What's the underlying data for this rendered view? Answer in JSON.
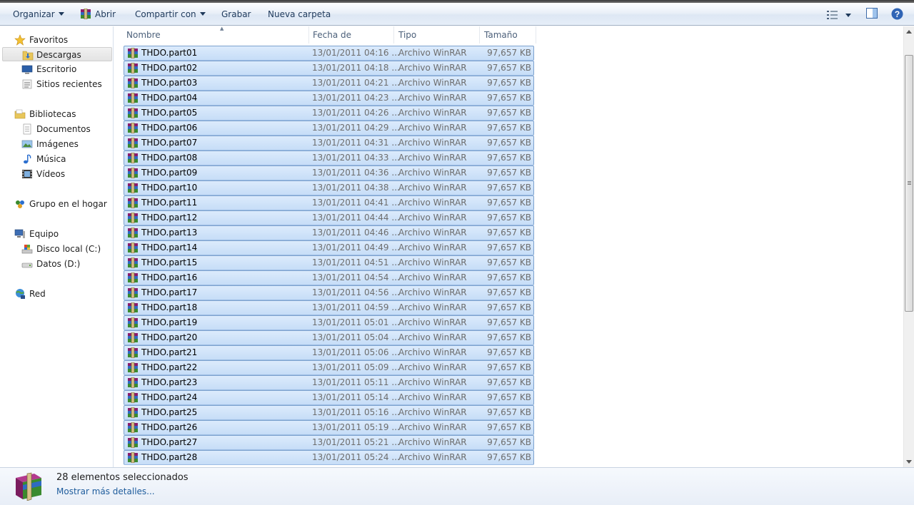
{
  "toolbar": {
    "organize": "Organizar",
    "open": "Abrir",
    "share": "Compartir con",
    "burn": "Grabar",
    "new_folder": "Nueva carpeta"
  },
  "nav": {
    "favorites": "Favoritos",
    "downloads": "Descargas",
    "desktop": "Escritorio",
    "recent": "Sitios recientes",
    "libraries": "Bibliotecas",
    "documents": "Documentos",
    "pictures": "Imágenes",
    "music": "Música",
    "videos": "Vídeos",
    "homegroup": "Grupo en el hogar",
    "computer": "Equipo",
    "local_disk": "Disco local (C:)",
    "data_disk": "Datos (D:)",
    "network": "Red"
  },
  "columns": {
    "name": "Nombre",
    "date": "Fecha de modifica...",
    "type": "Tipo",
    "size": "Tamaño"
  },
  "files": [
    {
      "name": "THDO.part01",
      "date": "13/01/2011 04:16 ...",
      "type": "Archivo WinRAR",
      "size": "97,657 KB"
    },
    {
      "name": "THDO.part02",
      "date": "13/01/2011 04:18 ...",
      "type": "Archivo WinRAR",
      "size": "97,657 KB"
    },
    {
      "name": "THDO.part03",
      "date": "13/01/2011 04:21 ...",
      "type": "Archivo WinRAR",
      "size": "97,657 KB"
    },
    {
      "name": "THDO.part04",
      "date": "13/01/2011 04:23 ...",
      "type": "Archivo WinRAR",
      "size": "97,657 KB"
    },
    {
      "name": "THDO.part05",
      "date": "13/01/2011 04:26 ...",
      "type": "Archivo WinRAR",
      "size": "97,657 KB"
    },
    {
      "name": "THDO.part06",
      "date": "13/01/2011 04:29 ...",
      "type": "Archivo WinRAR",
      "size": "97,657 KB"
    },
    {
      "name": "THDO.part07",
      "date": "13/01/2011 04:31 ...",
      "type": "Archivo WinRAR",
      "size": "97,657 KB"
    },
    {
      "name": "THDO.part08",
      "date": "13/01/2011 04:33 ...",
      "type": "Archivo WinRAR",
      "size": "97,657 KB"
    },
    {
      "name": "THDO.part09",
      "date": "13/01/2011 04:36 ...",
      "type": "Archivo WinRAR",
      "size": "97,657 KB"
    },
    {
      "name": "THDO.part10",
      "date": "13/01/2011 04:38 ...",
      "type": "Archivo WinRAR",
      "size": "97,657 KB"
    },
    {
      "name": "THDO.part11",
      "date": "13/01/2011 04:41 ...",
      "type": "Archivo WinRAR",
      "size": "97,657 KB"
    },
    {
      "name": "THDO.part12",
      "date": "13/01/2011 04:44 ...",
      "type": "Archivo WinRAR",
      "size": "97,657 KB"
    },
    {
      "name": "THDO.part13",
      "date": "13/01/2011 04:46 ...",
      "type": "Archivo WinRAR",
      "size": "97,657 KB"
    },
    {
      "name": "THDO.part14",
      "date": "13/01/2011 04:49 ...",
      "type": "Archivo WinRAR",
      "size": "97,657 KB"
    },
    {
      "name": "THDO.part15",
      "date": "13/01/2011 04:51 ...",
      "type": "Archivo WinRAR",
      "size": "97,657 KB"
    },
    {
      "name": "THDO.part16",
      "date": "13/01/2011 04:54 ...",
      "type": "Archivo WinRAR",
      "size": "97,657 KB"
    },
    {
      "name": "THDO.part17",
      "date": "13/01/2011 04:56 ...",
      "type": "Archivo WinRAR",
      "size": "97,657 KB"
    },
    {
      "name": "THDO.part18",
      "date": "13/01/2011 04:59 ...",
      "type": "Archivo WinRAR",
      "size": "97,657 KB"
    },
    {
      "name": "THDO.part19",
      "date": "13/01/2011 05:01 ...",
      "type": "Archivo WinRAR",
      "size": "97,657 KB"
    },
    {
      "name": "THDO.part20",
      "date": "13/01/2011 05:04 ...",
      "type": "Archivo WinRAR",
      "size": "97,657 KB"
    },
    {
      "name": "THDO.part21",
      "date": "13/01/2011 05:06 ...",
      "type": "Archivo WinRAR",
      "size": "97,657 KB"
    },
    {
      "name": "THDO.part22",
      "date": "13/01/2011 05:09 ...",
      "type": "Archivo WinRAR",
      "size": "97,657 KB"
    },
    {
      "name": "THDO.part23",
      "date": "13/01/2011 05:11 ...",
      "type": "Archivo WinRAR",
      "size": "97,657 KB"
    },
    {
      "name": "THDO.part24",
      "date": "13/01/2011 05:14 ...",
      "type": "Archivo WinRAR",
      "size": "97,657 KB"
    },
    {
      "name": "THDO.part25",
      "date": "13/01/2011 05:16 ...",
      "type": "Archivo WinRAR",
      "size": "97,657 KB"
    },
    {
      "name": "THDO.part26",
      "date": "13/01/2011 05:19 ...",
      "type": "Archivo WinRAR",
      "size": "97,657 KB"
    },
    {
      "name": "THDO.part27",
      "date": "13/01/2011 05:21 ...",
      "type": "Archivo WinRAR",
      "size": "97,657 KB"
    },
    {
      "name": "THDO.part28",
      "date": "13/01/2011 05:24 ...",
      "type": "Archivo WinRAR",
      "size": "97,657 KB"
    }
  ],
  "details": {
    "title": "28 elementos seleccionados",
    "link": "Mostrar más detalles..."
  },
  "colors": {
    "selection_fill": "#cce1f8",
    "selection_border": "#7da2ce",
    "link": "#1e5c9c",
    "toolbar_text": "#1e395b"
  },
  "icons": {
    "archive": "winrar-archive-icon",
    "view_menu": "view-options-icon",
    "preview": "preview-pane-icon",
    "help": "help-icon"
  }
}
